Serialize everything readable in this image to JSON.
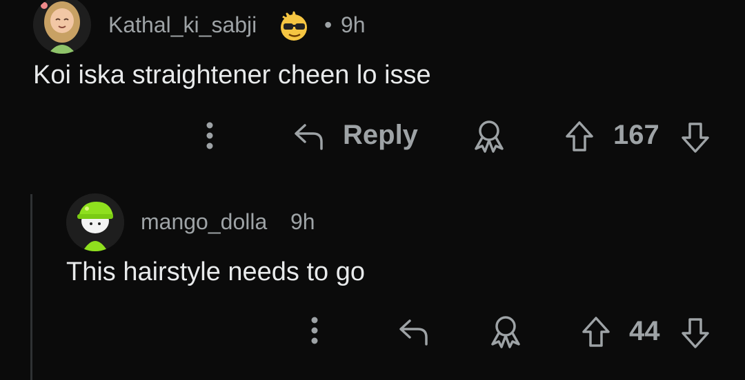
{
  "comments": [
    {
      "username": "Kathal_ki_sabji",
      "time_sep": "•",
      "time": "9h",
      "text": "Koi iska straightener cheen lo isse",
      "reply_label": "Reply",
      "score": "167"
    },
    {
      "username": "mango_dolla",
      "time": "9h",
      "text": "This hairstyle needs to go",
      "score": "44"
    }
  ],
  "icons": {
    "more": "more-vertical-icon",
    "reply": "reply-arrow-icon",
    "award": "award-ribbon-icon",
    "upvote": "upvote-arrow-icon",
    "downvote": "downvote-arrow-icon",
    "flair": "sunglasses-emoji-icon"
  },
  "colors": {
    "background": "#0b0b0b",
    "muted": "#9ea3a6",
    "text": "#e8eaeb"
  }
}
